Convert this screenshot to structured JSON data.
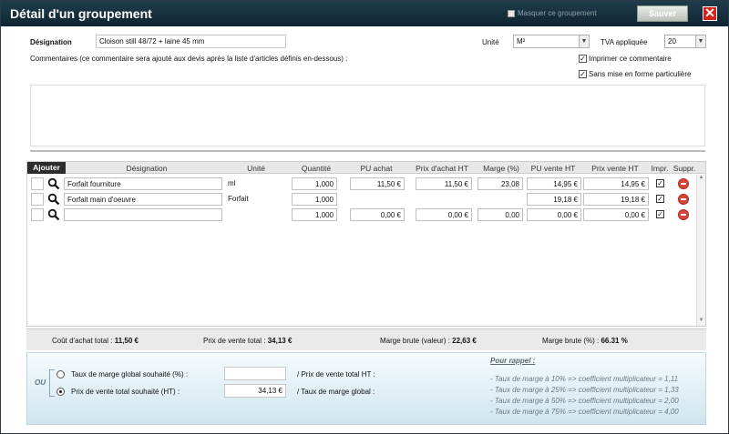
{
  "dialog": {
    "title": "Détail d'un groupement",
    "hide_group_label": "Masquer ce groupement",
    "save_label": "Sauver"
  },
  "form": {
    "designation_label": "Désignation",
    "designation_value": "Cloison still 48/72 + laine 45 mm",
    "unit_label": "Unité",
    "unit_value": "M²",
    "tva_label": "TVA appliquée",
    "tva_value": "20",
    "comments_label": "Commentaires (ce commentaire sera ajouté aux devis après la liste d'articles définis en-dessous) :",
    "print_comment_label": "Imprimer ce commentaire",
    "no_formatting_label": "Sans mise en forme particulière"
  },
  "grid": {
    "add_label": "Ajouter",
    "headers": {
      "designation": "Désignation",
      "unite": "Unité",
      "quantite": "Quantité",
      "pu_achat": "PU achat",
      "prix_achat_ht": "Prix d'achat HT",
      "marge": "Marge (%)",
      "pu_vente_ht": "PU vente HT",
      "prix_vente_ht": "Prix vente HT",
      "impr": "Impr.",
      "suppr": "Suppr."
    },
    "rows": [
      {
        "designation": "Forfait fourniture",
        "unite": "ml",
        "quantite": "1,000",
        "pu_achat": "11,50 €",
        "prix_achat_ht": "11,50 €",
        "marge": "23,08",
        "pu_vente_ht": "14,95 €",
        "prix_vente_ht": "14,95 €",
        "impr": "✓"
      },
      {
        "designation": "Forfait main d'oeuvre",
        "unite": "Forfait",
        "quantite": "1,000",
        "pu_achat": "",
        "prix_achat_ht": "",
        "marge": "",
        "pu_vente_ht": "19,18 €",
        "prix_vente_ht": "19,18 €",
        "impr": "✓"
      },
      {
        "designation": "",
        "unite": "",
        "quantite": "1,000",
        "pu_achat": "0,00 €",
        "prix_achat_ht": "0,00 €",
        "marge": "0,00",
        "pu_vente_ht": "0,00 €",
        "prix_vente_ht": "0,00 €",
        "impr": "✓"
      }
    ]
  },
  "totals": {
    "cout_label": "Coût d'achat total :",
    "cout_value": "11,50 €",
    "vente_label": "Prix de vente total :",
    "vente_value": "34,13 €",
    "marge_valeur_label": "Marge brute (valeur) :",
    "marge_valeur_value": "22,63 €",
    "marge_pct_label": "Marge brute (%) :",
    "marge_pct_value": "66.31 %"
  },
  "bottom": {
    "ou_label": "OU",
    "taux_label": "Taux de marge global souhaité (%) :",
    "taux_value": "",
    "taux_result_label": "/ Prix de vente total HT :",
    "prix_label": "Prix de vente total souhaité (HT) :",
    "prix_value": "34,13 €",
    "prix_result_label": "/ Taux de marge global :",
    "rappel_title": "Pour rappel :",
    "rappel_lines": [
      "- Taux de marge à 10% => coefficient multiplicateur = 1,11",
      "- Taux de marge à 25% => coefficient multiplicateur = 1,33",
      "- Taux de marge à 50% => coefficient multiplicateur = 2,00",
      "- Taux de marge à 75% => coefficient multiplicateur = 4,00"
    ]
  }
}
